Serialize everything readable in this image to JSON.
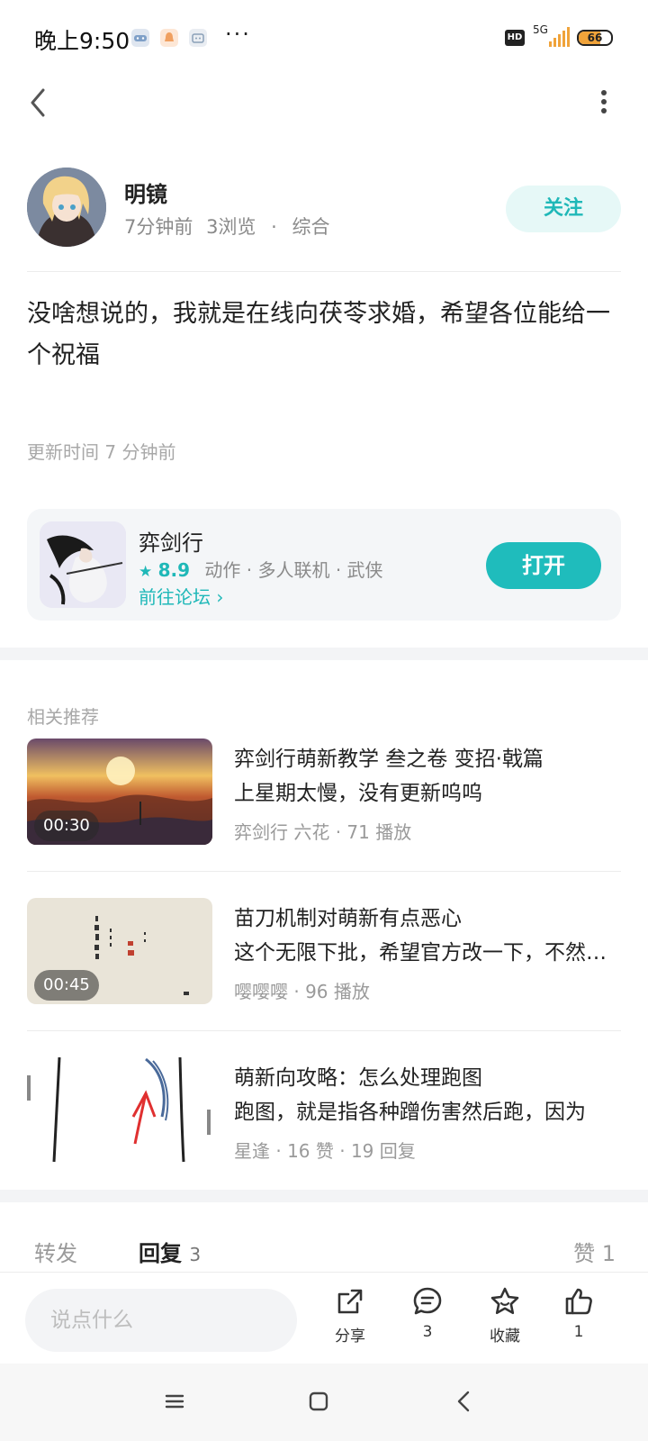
{
  "status_bar": {
    "time": "晚上9:50",
    "more": "···",
    "hd": "HD",
    "network": "5G",
    "battery": "66",
    "battery_level": 0.66
  },
  "header": {
    "back_icon": "chevron-left-icon",
    "menu_icon": "more-vertical-icon"
  },
  "author": {
    "name": "明镜",
    "time": "7分钟前",
    "views": "3浏览",
    "dot": "·",
    "category": "综合",
    "follow_label": "关注"
  },
  "post": {
    "text": "没啥想说的，我就是在线向茯苓求婚，希望各位能给一个祝福",
    "update_time": "更新时间 7 分钟前"
  },
  "game_card": {
    "name": "弈剑行",
    "rating": "8.9",
    "tags": "动作 · 多人联机 · 武侠",
    "forum_link": "前往论坛 ›",
    "open_label": "打开"
  },
  "related": {
    "title": "相关推荐",
    "items": [
      {
        "title": "弈剑行萌新教学 叁之卷 变招·戟篇",
        "subtitle": "上星期太慢，没有更新呜呜",
        "meta": "弈剑行 六花 · 71 播放",
        "duration": "00:30"
      },
      {
        "title": "苗刀机制对萌新有点恶心",
        "subtitle": "这个无限下批，希望官方改一下，不然真的",
        "meta": "嘤嘤嘤 · 96 播放",
        "duration": "00:45"
      },
      {
        "title": "萌新向攻略：怎么处理跑图",
        "subtitle": "跑图，就是指各种蹭伤害然后跑，因为",
        "meta": "星逢 · 16 赞 · 19 回复",
        "duration": ""
      }
    ]
  },
  "tabs": {
    "repost": "转发",
    "reply": "回复",
    "reply_count": "3",
    "like": "赞 1"
  },
  "bottom_bar": {
    "input_placeholder": "说点什么",
    "share_label": "分享",
    "comment_count": "3",
    "favorite_label": "收藏",
    "like_count": "1"
  },
  "colors": {
    "accent": "#1fb8b8",
    "follow_bg": "#e6f8f7",
    "card_bg": "#f4f6f8"
  }
}
